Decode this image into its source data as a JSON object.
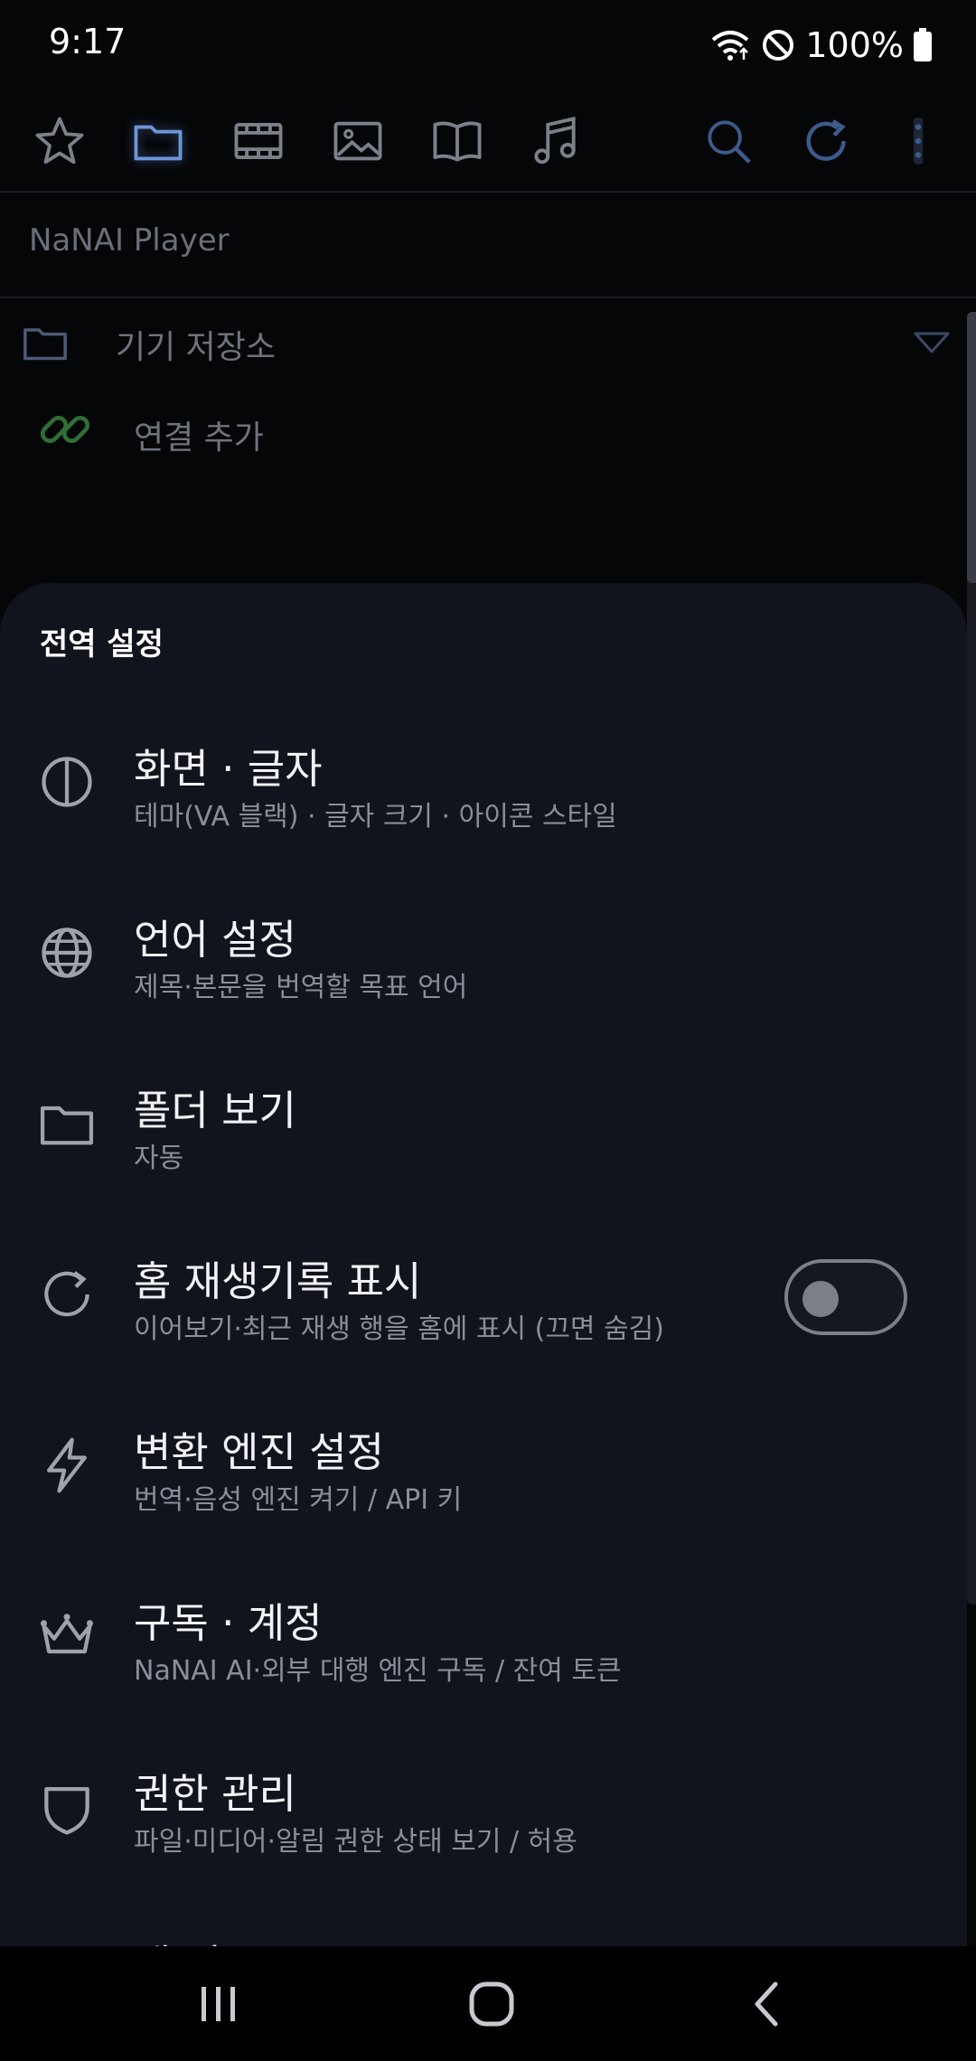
{
  "status_bar": {
    "time": "9:17",
    "battery_percent": "100%",
    "icons": [
      "wifi-icon",
      "do-not-disturb-icon",
      "battery-icon"
    ]
  },
  "toolbar": {
    "icons": [
      "favorites-star-icon",
      "folder-icon",
      "video-film-icon",
      "image-icon",
      "book-icon",
      "music-note-icon",
      "search-icon",
      "refresh-icon",
      "more-vert-icon"
    ],
    "active_icon": "folder-icon",
    "accent_color": "#3d5a8c"
  },
  "app": {
    "title": "NaNAI Player"
  },
  "storage": {
    "device_storage_label": "기기 저장소",
    "add_connection_label": "연결 추가",
    "link_icon_color": "#2f6f35"
  },
  "sheet": {
    "title": "전역 설정",
    "items": [
      {
        "icon": "contrast-icon",
        "title": "화면 · 글자",
        "subtitle": "테마(VA 블랙) · 글자 크기 · 아이콘 스타일"
      },
      {
        "icon": "globe-icon",
        "title": "언어 설정",
        "subtitle": "제목·본문을 번역할 목표 언어"
      },
      {
        "icon": "folder-icon",
        "title": "폴더 보기",
        "subtitle": "자동"
      },
      {
        "icon": "refresh-icon",
        "title": "홈 재생기록 표시",
        "subtitle": "이어보기·최근 재생 행을 홈에 표시 (끄면 숨김)",
        "toggle": false
      },
      {
        "icon": "lightning-icon",
        "title": "변환 엔진 설정",
        "subtitle": "번역·음성 엔진 켜기 / API 키"
      },
      {
        "icon": "crown-icon",
        "title": "구독 · 계정",
        "subtitle": "NaNAI AI·외부 대행 엔진 구독 / 잔여 토큰"
      },
      {
        "icon": "shield-icon",
        "title": "권한 관리",
        "subtitle": "파일·미디어·알림 권한 상태 보기 / 허용"
      },
      {
        "icon": "tool-icon",
        "title": "앱 지도",
        "subtitle": ""
      }
    ]
  },
  "navbar": {
    "icons": [
      "recent-apps-icon",
      "home-icon",
      "back-icon"
    ]
  }
}
